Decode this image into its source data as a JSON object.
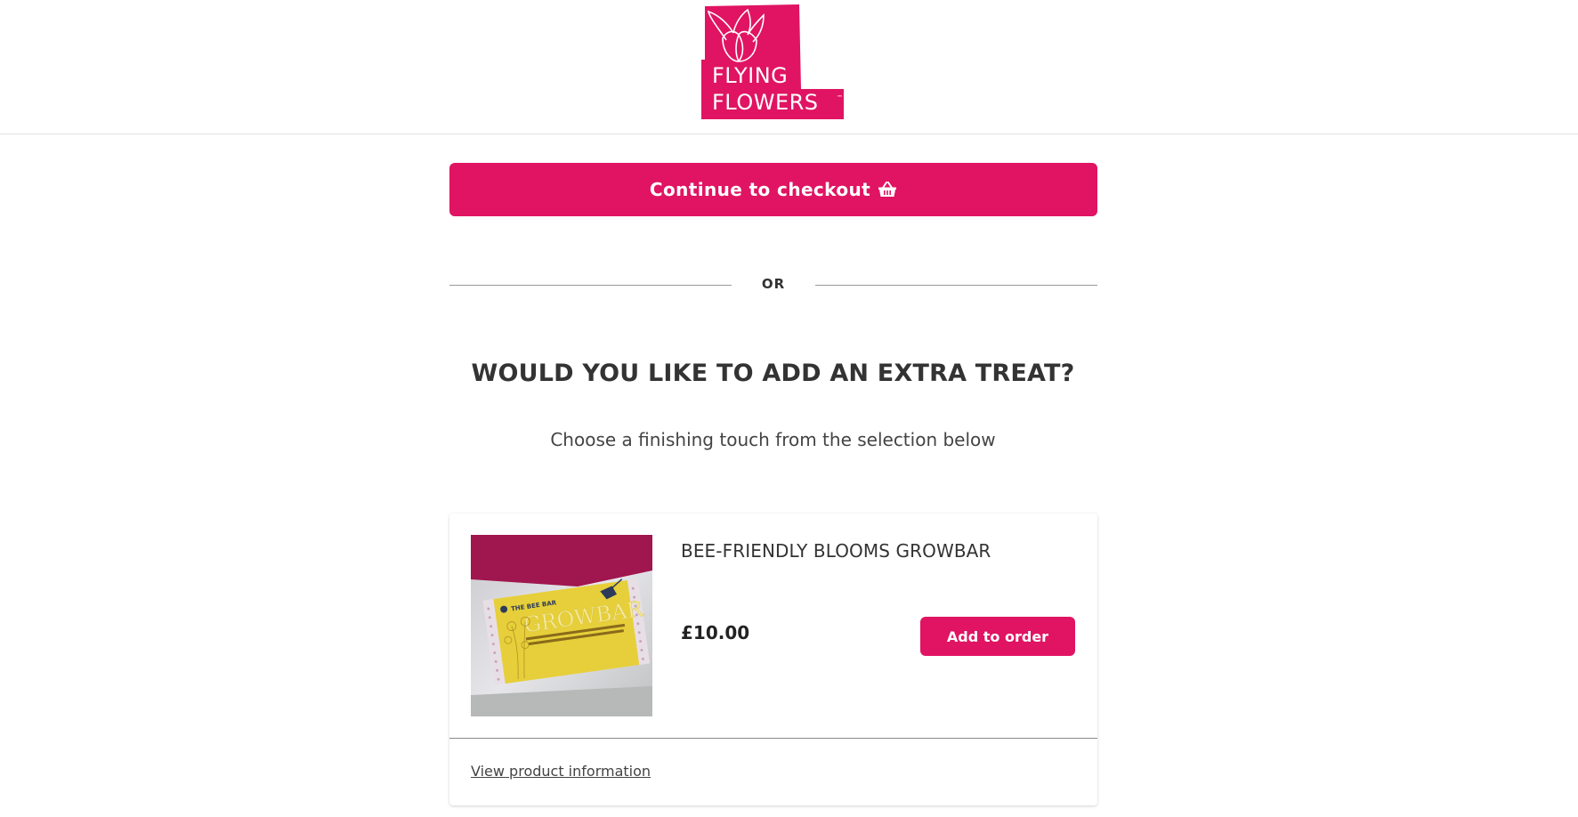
{
  "brand": {
    "logo_line1": "FLYING",
    "logo_line2": "FLOWERS",
    "logo_tm": "™",
    "color": "#e01462"
  },
  "checkout": {
    "label": "Continue to checkout",
    "icon": "basket-icon"
  },
  "separator": {
    "label": "OR"
  },
  "upsell": {
    "title": "WOULD YOU LIKE TO ADD AN EXTRA TREAT?",
    "subtitle": "Choose a finishing touch from the selection below"
  },
  "product": {
    "name": "BEE-FRIENDLY BLOOMS GROWBAR",
    "price": "£10.00",
    "add_label": "Add to order",
    "info_link": "View product information",
    "image_text": {
      "brand": "THE BEE BAR",
      "product": "GROWBAR"
    }
  }
}
